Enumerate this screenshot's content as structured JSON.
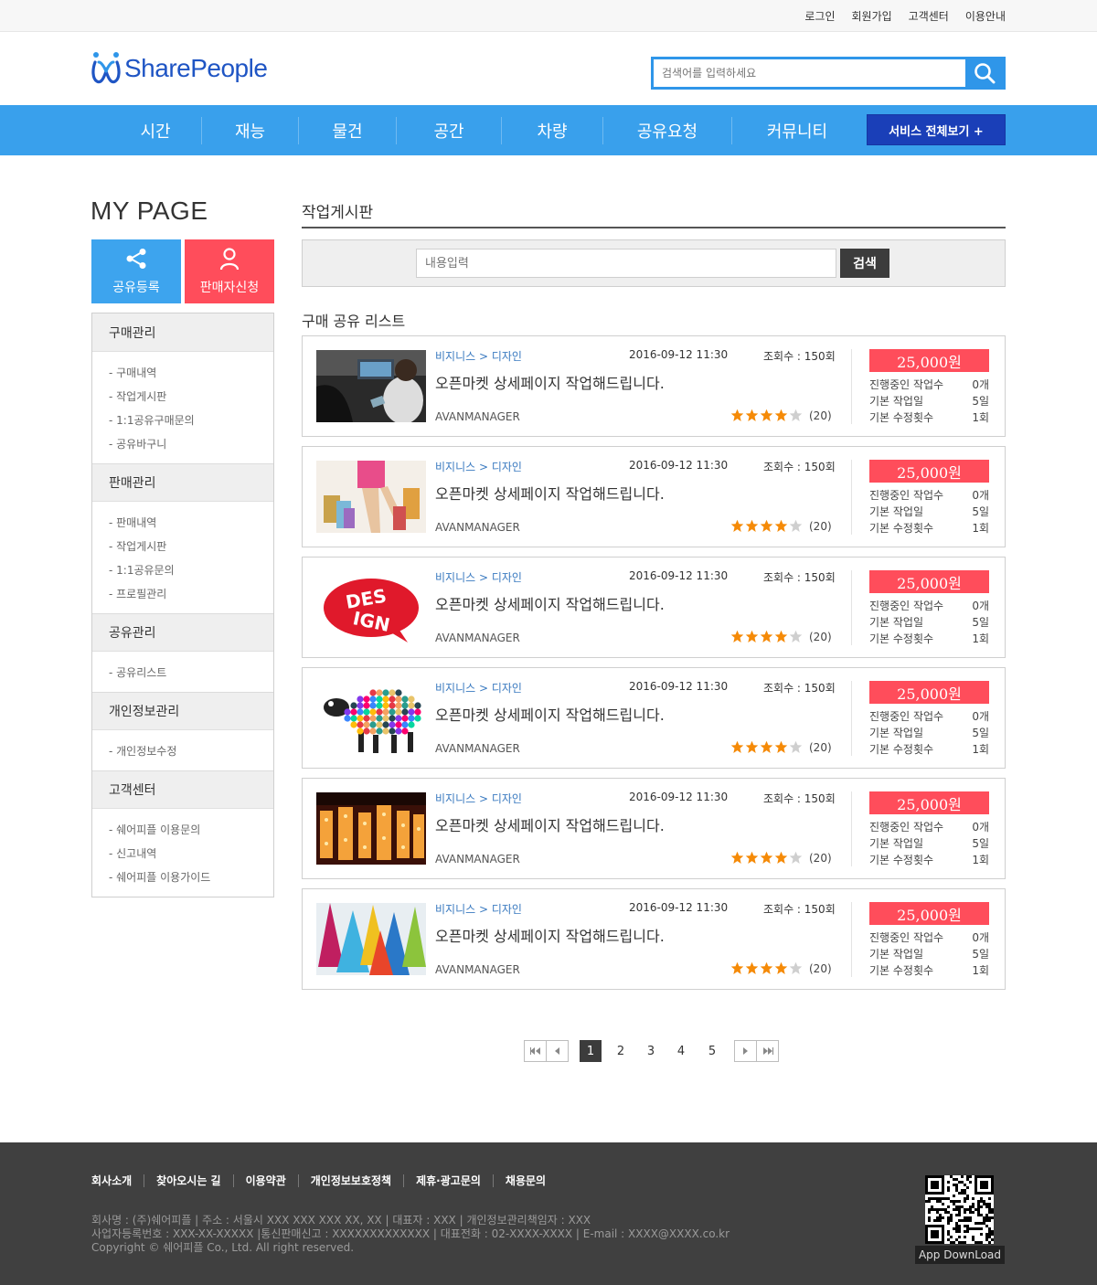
{
  "top_links": [
    "로그인",
    "회원가입",
    "고객센터",
    "이용안내"
  ],
  "brand": {
    "name": "SharePeople",
    "color": "#1f55c4"
  },
  "search": {
    "placeholder": "검색어를 입력하세요"
  },
  "nav": {
    "items": [
      "시간",
      "재능",
      "물건",
      "공간",
      "차량",
      "공유요청",
      "커뮤니티"
    ],
    "all_label": "서비스 전체보기  +"
  },
  "sidebar": {
    "title": "MY PAGE",
    "quick": [
      {
        "label": "공유등록",
        "icon": "share-icon"
      },
      {
        "label": "판매자신청",
        "icon": "user-icon"
      }
    ],
    "groups": [
      {
        "title": "구매관리",
        "items": [
          "- 구매내역",
          "- 작업게시판",
          "- 1:1공유구매문의",
          "- 공유바구니"
        ]
      },
      {
        "title": "판매관리",
        "items": [
          "- 판매내역",
          "- 작업게시판",
          "- 1:1공유문의",
          "- 프로필관리"
        ]
      },
      {
        "title": "공유관리",
        "items": [
          "- 공유리스트"
        ]
      },
      {
        "title": "개인정보관리",
        "items": [
          "- 개인정보수정"
        ]
      },
      {
        "title": "고객센터",
        "items": [
          "- 쉐어피플 이용문의",
          "- 신고내역",
          "- 쉐어피플 이용가이드"
        ]
      }
    ]
  },
  "main": {
    "title": "작업게시판",
    "board_search": {
      "placeholder": "내용입력",
      "button": "검색"
    },
    "list_title": "구매 공유 리스트",
    "cards": [
      {
        "thumb": "car-photo",
        "category": "비지니스 > 디자인",
        "date": "2016-09-12 11:30",
        "views": "조회수 : 150회",
        "title": "오픈마켓 상세페이지 작업해드립니다.",
        "author": "AVANMANAGER",
        "rating": 4,
        "review_count": "(20)",
        "price": "25,000원",
        "info": [
          [
            "진행중인 작업수",
            "0개"
          ],
          [
            "기본 작업일",
            "5일"
          ],
          [
            "기본 수정횟수",
            "1회"
          ]
        ]
      },
      {
        "thumb": "shopping-photo",
        "category": "비지니스 > 디자인",
        "date": "2016-09-12 11:30",
        "views": "조회수 : 150회",
        "title": "오픈마켓 상세페이지 작업해드립니다.",
        "author": "AVANMANAGER",
        "rating": 4,
        "review_count": "(20)",
        "price": "25,000원",
        "info": [
          [
            "진행중인 작업수",
            "0개"
          ],
          [
            "기본 작업일",
            "5일"
          ],
          [
            "기본 수정횟수",
            "1회"
          ]
        ]
      },
      {
        "thumb": "design-logo",
        "category": "비지니스 > 디자인",
        "date": "2016-09-12 11:30",
        "views": "조회수 : 150회",
        "title": "오픈마켓 상세페이지 작업해드립니다.",
        "author": "AVANMANAGER",
        "rating": 4,
        "review_count": "(20)",
        "price": "25,000원",
        "info": [
          [
            "진행중인 작업수",
            "0개"
          ],
          [
            "기본 작업일",
            "5일"
          ],
          [
            "기본 수정횟수",
            "1회"
          ]
        ]
      },
      {
        "thumb": "sheep-photo",
        "category": "비지니스 > 디자인",
        "date": "2016-09-12 11:30",
        "views": "조회수 : 150회",
        "title": "오픈마켓 상세페이지 작업해드립니다.",
        "author": "AVANMANAGER",
        "rating": 4,
        "review_count": "(20)",
        "price": "25,000원",
        "info": [
          [
            "진행중인 작업수",
            "0개"
          ],
          [
            "기본 작업일",
            "5일"
          ],
          [
            "기본 수정횟수",
            "1회"
          ]
        ]
      },
      {
        "thumb": "lights-photo",
        "category": "비지니스 > 디자인",
        "date": "2016-09-12 11:30",
        "views": "조회수 : 150회",
        "title": "오픈마켓 상세페이지 작업해드립니다.",
        "author": "AVANMANAGER",
        "rating": 4,
        "review_count": "(20)",
        "price": "25,000원",
        "info": [
          [
            "진행중인 작업수",
            "0개"
          ],
          [
            "기본 작업일",
            "5일"
          ],
          [
            "기본 수정횟수",
            "1회"
          ]
        ]
      },
      {
        "thumb": "cones-photo",
        "category": "비지니스 > 디자인",
        "date": "2016-09-12 11:30",
        "views": "조회수 : 150회",
        "title": "오픈마켓 상세페이지 작업해드립니다.",
        "author": "AVANMANAGER",
        "rating": 4,
        "review_count": "(20)",
        "price": "25,000원",
        "info": [
          [
            "진행중인 작업수",
            "0개"
          ],
          [
            "기본 작업일",
            "5일"
          ],
          [
            "기본 수정횟수",
            "1회"
          ]
        ]
      }
    ]
  },
  "pagination": {
    "pages": [
      "1",
      "2",
      "3",
      "4",
      "5"
    ],
    "current": "1"
  },
  "footer": {
    "links": [
      "회사소개",
      "찾아오시는 길",
      "이용약관",
      "개인정보보호정책",
      "제휴·광고문의",
      "채용문의"
    ],
    "info_lines": [
      "회사명 : (주)쉐어피플  |  주소 : 서울시 XXX XXX XXX XX, XX   |  대표자 : XXX  |  개인정보관리책임자 : XXX",
      "사업자등록번호 : XXX-XX-XXXXX  |통신판매신고 : XXXXXXXXXXXXX  | 대표전화 : 02-XXXX-XXXX  |  E-mail : XXXX@XXXX.co.kr",
      "Copyright © 쉐어피플 Co., Ltd. All right reserved."
    ],
    "app_download": "App DownLoad"
  },
  "colors": {
    "nav_blue": "#39a0ec",
    "dark_blue": "#1a3fb8",
    "accent_red": "#ff4d5b",
    "star_orange": "#f58a07"
  }
}
